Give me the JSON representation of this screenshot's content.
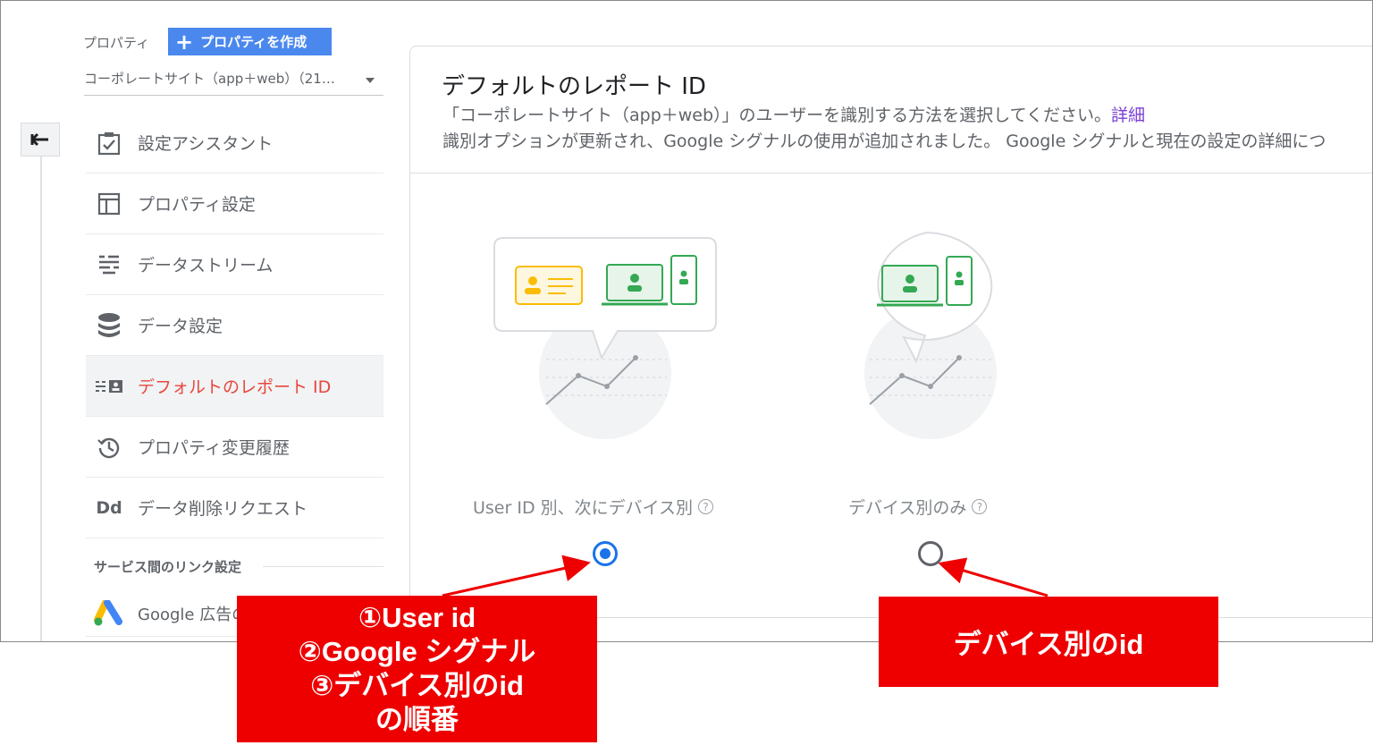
{
  "property": {
    "label": "プロパティ",
    "create_button": "プロパティを作成",
    "selected": "コーポレートサイト（app＋web）（21…"
  },
  "nav": [
    {
      "label": "設定アシスタント",
      "icon": "checklist-icon"
    },
    {
      "label": "プロパティ設定",
      "icon": "layout-icon"
    },
    {
      "label": "データストリーム",
      "icon": "stream-icon"
    },
    {
      "label": "データ設定",
      "icon": "database-icon"
    },
    {
      "label": "デフォルトのレポート ID",
      "icon": "report-id-icon",
      "active": true
    },
    {
      "label": "プロパティ変更履歴",
      "icon": "history-icon"
    },
    {
      "label": "データ削除リクエスト",
      "icon": "dd-icon"
    }
  ],
  "nav_icon_dd": "Dd",
  "links_section": {
    "title": "サービス間のリンク設定",
    "ads_label": "Google 広告の"
  },
  "content": {
    "title": "デフォルトのレポート ID",
    "desc_line1": "「コーポレートサイト（app＋web）」のユーザーを識別する方法を選択してください。",
    "desc_link": "詳細",
    "desc_line2": "識別オプションが更新され、Google シグナルの使用が追加されました。 Google シグナルと現在の設定の詳細につ",
    "options": [
      {
        "label": "User ID 別、次にデバイス別",
        "selected": true
      },
      {
        "label": "デバイス別のみ",
        "selected": false
      }
    ],
    "help_glyph": "?"
  },
  "annotations": {
    "callout1_lines": [
      "①User id",
      "②Google シグナル",
      "③デバイス別のid",
      "の順番"
    ],
    "callout2": "デバイス別のid"
  },
  "colors": {
    "accent_blue": "#1a73e8",
    "create_button": "#4a88ee",
    "active_nav_text": "#e8473e",
    "link_purple": "#7b3fd6",
    "annotation_red": "#ee0000"
  }
}
